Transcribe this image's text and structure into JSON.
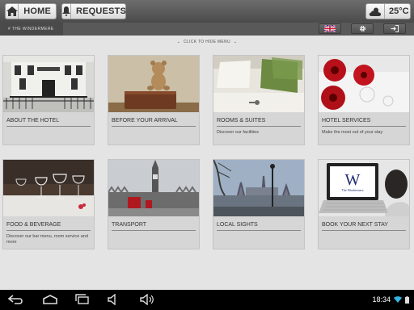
{
  "header": {
    "home_label": "HOME",
    "requests_label": "REQUESTS",
    "temperature": "25°C"
  },
  "subbar": {
    "brand": "# THE WINDERMERE"
  },
  "menu_toggle": {
    "label": "CLICK TO HIDE MENU"
  },
  "tiles": [
    {
      "title": "ABOUT THE HOTEL",
      "desc": ""
    },
    {
      "title": "BEFORE YOUR ARRIVAL",
      "desc": ""
    },
    {
      "title": "ROOMS & SUITES",
      "desc": "Discover our facilities"
    },
    {
      "title": "HOTEL SERVICES",
      "desc": "Make the most out of your stay"
    },
    {
      "title": "FOOD & BEVERAGE",
      "desc": "Discover our bar menu, room service and more"
    },
    {
      "title": "TRANSPORT",
      "desc": ""
    },
    {
      "title": "LOCAL SIGHTS",
      "desc": ""
    },
    {
      "title": "BOOK YOUR NEXT STAY",
      "desc": ""
    }
  ],
  "book_image": {
    "logo_letter": "W",
    "logo_text": "The Windermere"
  },
  "statusbar": {
    "time": "18:34"
  },
  "colors": {
    "top_bar": "#5a5a5a",
    "tile_bg": "#d6d6d6",
    "page_bg": "#e4e4e4",
    "wifi": "#33b5e5"
  }
}
